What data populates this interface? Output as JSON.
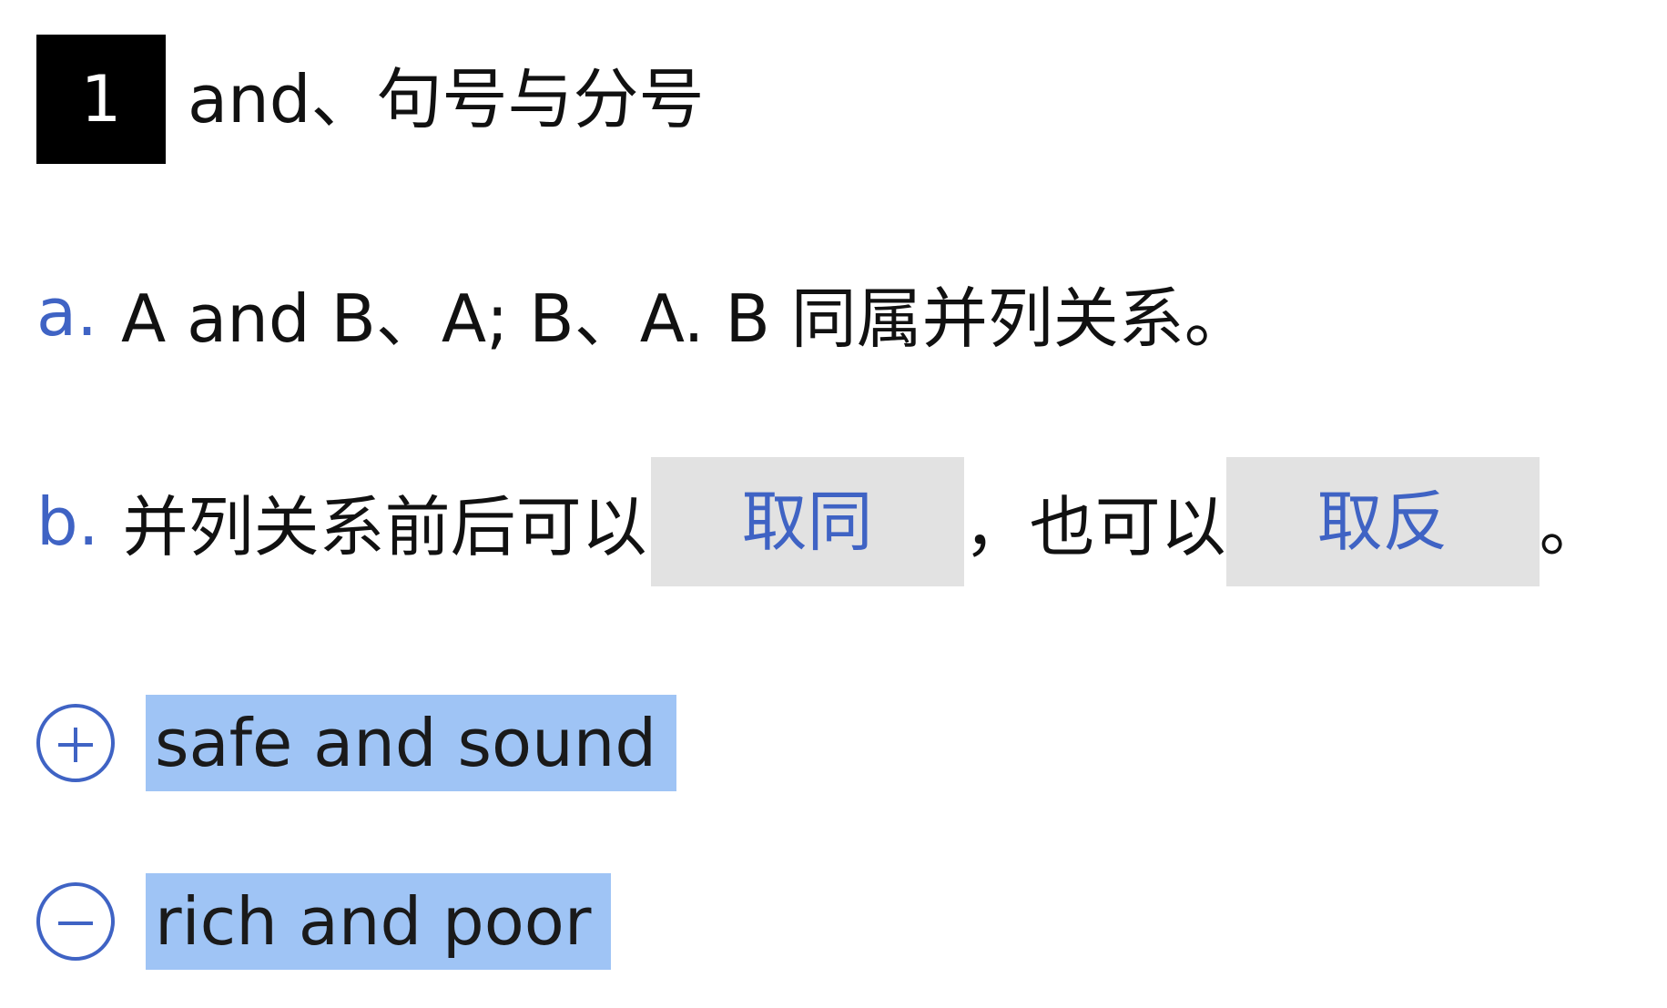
{
  "heading": {
    "number": "1",
    "title": "and、句号与分号"
  },
  "points": {
    "a": {
      "marker": "a.",
      "text": "A and B、A; B、A. B 同属并列关系。"
    },
    "b": {
      "marker": "b.",
      "prefix": "并列关系前后可以",
      "blank1": "取同",
      "middle": "，也可以",
      "blank2": "取反",
      "end": "。"
    }
  },
  "examples": [
    {
      "icon": "plus-circle-icon",
      "phrase": "safe and sound"
    },
    {
      "icon": "minus-circle-icon",
      "phrase": "rich and poor"
    }
  ],
  "colors": {
    "accent": "#3f63c4",
    "highlight": "#9fc4f5",
    "blank_bg": "#e2e2e2",
    "badge_bg": "#000000"
  }
}
